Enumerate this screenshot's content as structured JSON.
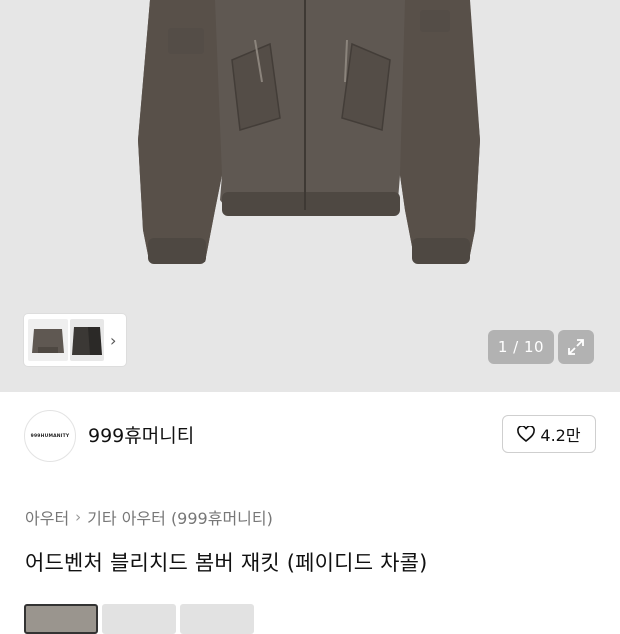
{
  "gallery": {
    "counter": "1 / 10",
    "icons": {
      "next": "chevron-right-icon",
      "expand": "expand-icon"
    }
  },
  "brand": {
    "logo_text": "999HUMANITY",
    "name": "999휴머니티"
  },
  "like": {
    "icon": "heart-icon",
    "count": "4.2만"
  },
  "breadcrumb": [
    "아우터",
    "기타 아우터 (999휴머니티)"
  ],
  "product": {
    "title": "어드벤처 블리치드 봄버 재킷 (페이디드 차콜)"
  },
  "colors": {
    "jacket": "#5f5852",
    "background": "#e6e6e6",
    "badge": "#a0a0a0"
  }
}
